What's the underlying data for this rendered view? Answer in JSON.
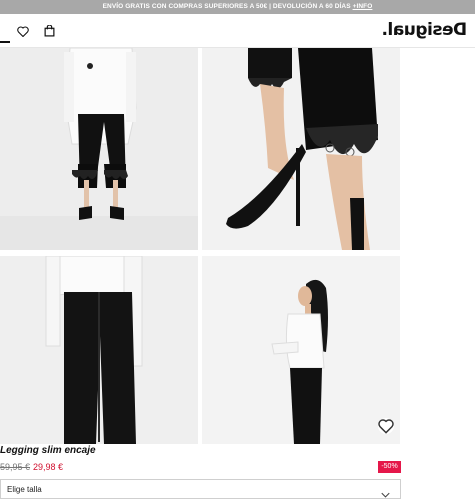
{
  "promo": {
    "text": "ENVÍO GRATIS CON COMPRAS SUPERIORES A 50€ | DEVOLUCIÓN A 60 DÍAS",
    "link": "+INFO"
  },
  "header": {
    "logo": "Desigual.",
    "icons": [
      "menu-icon",
      "heart-icon",
      "bag-icon"
    ]
  },
  "gallery": {
    "images": [
      "model-front-full-body",
      "lace-hem-closeup",
      "model-back-legging",
      "model-side-profile"
    ]
  },
  "product": {
    "name": "Legging slim encaje",
    "old_price": "59,95 €",
    "new_price": "29,98 €",
    "discount": "-50%",
    "sale_color": "#d0102f",
    "badge_color": "#e5174a"
  },
  "size": {
    "label": "Elige talla"
  }
}
